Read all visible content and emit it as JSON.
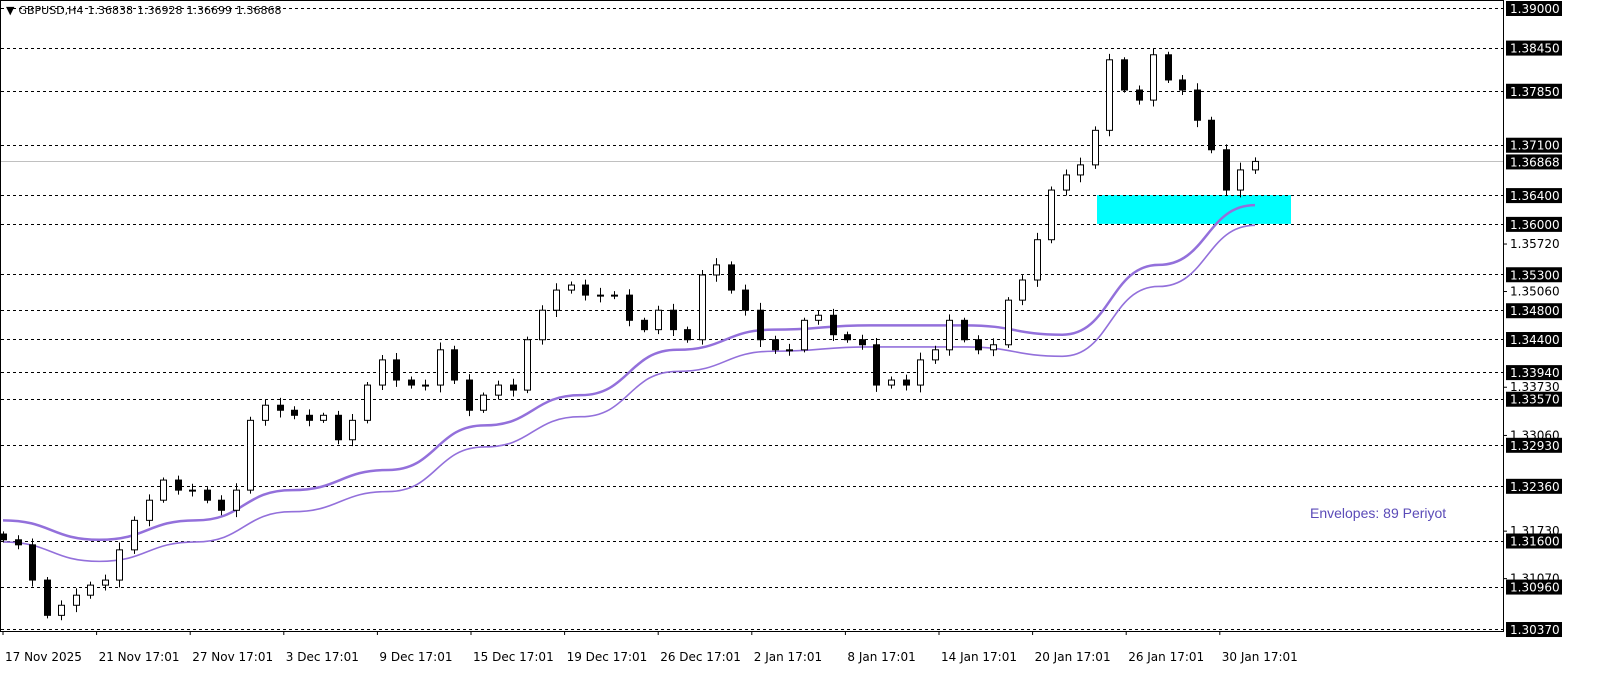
{
  "header": {
    "symbol": "GBPUSD,H4",
    "open": "1.36838",
    "high": "1.36928",
    "low": "1.36699",
    "close": "1.36868"
  },
  "chart_data": {
    "type": "candlestick",
    "ylim": [
      1.3012,
      1.391
    ],
    "grid": false,
    "colors": {
      "candle": "#000000",
      "envelope": "#9370DB",
      "zone": "#00FFFF",
      "current_price_line": "#C0C0C0",
      "label_text": "#5B4BB8"
    },
    "closes": [
      1.3161,
      1.3154,
      1.3105,
      1.3056,
      1.307,
      1.3084,
      1.3098,
      1.3105,
      1.3147,
      1.3188,
      1.3216,
      1.3244,
      1.323,
      1.323,
      1.3216,
      1.3202,
      1.323,
      1.3327,
      1.3348,
      1.3341,
      1.3334,
      1.3327,
      1.3334,
      1.33,
      1.3327,
      1.3376,
      1.3411,
      1.3383,
      1.3376,
      1.3376,
      1.3425,
      1.3383,
      1.3341,
      1.3362,
      1.3376,
      1.3369,
      1.3439,
      1.348,
      1.3508,
      1.3515,
      1.3501,
      1.3501,
      1.3501,
      1.3466,
      1.3453,
      1.348,
      1.3453,
      1.3439,
      1.3529,
      1.3543,
      1.3508,
      1.348,
      1.3439,
      1.3425,
      1.3425,
      1.3466,
      1.3473,
      1.3446,
      1.3439,
      1.3432,
      1.3376,
      1.3383,
      1.3376,
      1.3411,
      1.3425,
      1.3466,
      1.3439,
      1.3425,
      1.3432,
      1.3494,
      1.3522,
      1.3578,
      1.3647,
      1.3668,
      1.3682,
      1.373,
      1.3828,
      1.3786,
      1.3772,
      1.3835,
      1.38,
      1.3786,
      1.3744,
      1.3703,
      1.3647,
      1.3675,
      1.36868
    ],
    "envelope_upper": [
      1.3188,
      1.3161,
      1.3188,
      1.323,
      1.3258,
      1.332,
      1.3362,
      1.3425,
      1.3453,
      1.3459,
      1.3459,
      1.3446,
      1.3543,
      1.3626
    ],
    "envelope_lower": [
      1.3158,
      1.3131,
      1.3158,
      1.32,
      1.3228,
      1.329,
      1.3332,
      1.3395,
      1.3423,
      1.3429,
      1.3429,
      1.3416,
      1.3513,
      1.3598
    ],
    "zone": {
      "top": 1.364,
      "bottom": 1.36
    },
    "current_price": 1.36868,
    "level_lines": [
      "1.39000",
      "1.38450",
      "1.37850",
      "1.37100",
      "1.36400",
      "1.36000",
      "1.35300",
      "1.34800",
      "1.34400",
      "1.33940",
      "1.33570",
      "1.32930",
      "1.32360",
      "1.31600",
      "1.30960",
      "1.30370"
    ],
    "current_price_label": "1.36868",
    "axis_ticks": [
      "1.35720",
      "1.35060",
      "1.33730",
      "1.33060",
      "1.31730",
      "1.31070"
    ],
    "x_ticks": [
      "17 Nov 2025",
      "21 Nov 17:01",
      "27 Nov 17:01",
      "3 Dec 17:01",
      "9 Dec 17:01",
      "15 Dec 17:01",
      "19 Dec 17:01",
      "26 Dec 17:01",
      "2 Jan 17:01",
      "8 Jan 17:01",
      "14 Jan 17:01",
      "20 Jan 17:01",
      "26 Jan 17:01",
      "30 Jan 17:01"
    ],
    "annotation": "Envelopes: 89 Periyot"
  }
}
